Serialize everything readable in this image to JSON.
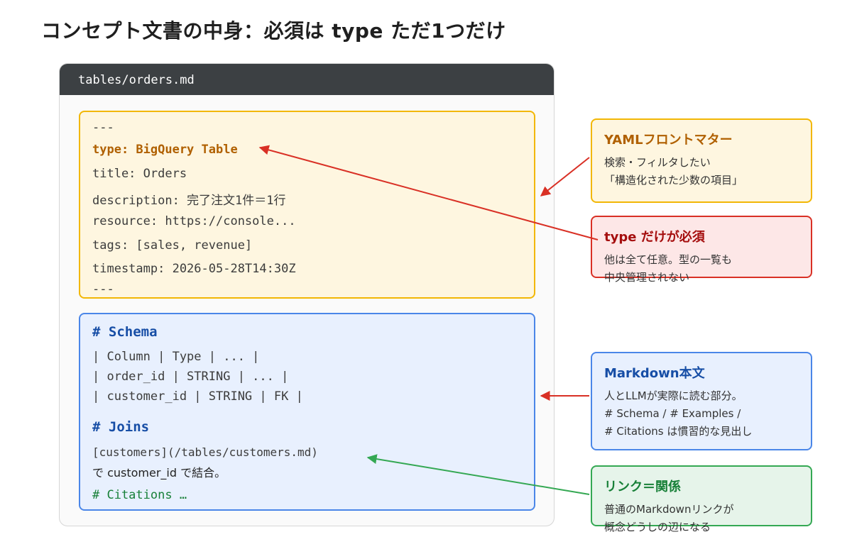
{
  "title": "コンセプト文書の中身：必須は type ただ1つだけ",
  "file": {
    "name": "tables/orders.md",
    "frontmatter": {
      "open_delim": "---",
      "type_line": "type: BigQuery Table",
      "title_line": "title: Orders",
      "description_line": "description: 完了注文1件＝1行",
      "resource_line": "resource: https://console...",
      "tags_line": "tags: [sales, revenue]",
      "timestamp_line": "timestamp: 2026-05-28T14:30Z",
      "close_delim": "---"
    },
    "body": {
      "schema_heading": "# Schema",
      "schema_rows": [
        "| Column | Type | ... |",
        "| order_id | STRING | ... |",
        "| customer_id | STRING | FK |"
      ],
      "joins_heading": "# Joins",
      "joins_link": "[customers](/tables/customers.md)",
      "joins_text": "で customer_id で結合。",
      "citations": "# Citations …"
    }
  },
  "notes": {
    "yaml": {
      "title": "YAMLフロントマター",
      "lines": [
        "検索・フィルタしたい",
        "「構造化された少数の項目」"
      ]
    },
    "type": {
      "title": "type だけが必須",
      "lines": [
        "他は全て任意。型の一覧も",
        "中央管理されない"
      ]
    },
    "markdown": {
      "title": "Markdown本文",
      "lines": [
        "人とLLMが実際に読む部分。",
        "# Schema / # Examples /",
        "# Citations は慣習的な見出し"
      ]
    },
    "link": {
      "title": "リンク＝関係",
      "lines": [
        "普通のMarkdownリンクが",
        "概念どうしの辺になる"
      ]
    }
  },
  "colors": {
    "yaml": "#f2b705",
    "type": "#d93025",
    "markdown": "#4a86e8",
    "link": "#34a853",
    "header": "#3c4043"
  }
}
